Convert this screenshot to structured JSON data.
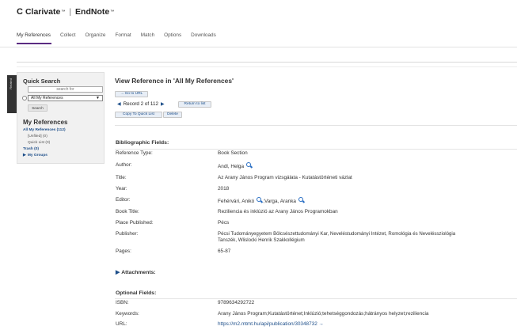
{
  "brand": {
    "logo": "C",
    "name": "Clarivate",
    "tm": "™",
    "product": "EndNote",
    "tm2": "™"
  },
  "nav": [
    "My References",
    "Collect",
    "Organize",
    "Format",
    "Match",
    "Options",
    "Downloads"
  ],
  "side_tab": "Related",
  "quick_search": {
    "title": "Quick Search",
    "search_placeholder": "search for",
    "select_value": "All My References",
    "search_button": "Search"
  },
  "my_references": {
    "title": "My References",
    "all": "All My References (112)",
    "unfiled": "[Unfiled] (0)",
    "quick_list": "Quick List (0)",
    "trash": "Trash (0)",
    "groups": "My Groups"
  },
  "view": {
    "title": "View Reference in 'All My References'",
    "goto_url": "Go to URL",
    "record_text": "Record 2 of 112",
    "return_to_list": "Return to list",
    "copy_to_quick_list": "Copy To Quick List",
    "delete": "Delete"
  },
  "bibliographic": {
    "heading": "Bibliographic Fields:",
    "reference_type_label": "Reference Type:",
    "reference_type": "Book Section",
    "author_label": "Author:",
    "author": "Andl, Helga",
    "title_label": "Title:",
    "title": "Az Arany János Program vizsgálata - Kutatástörténeti vázlat",
    "year_label": "Year:",
    "year": "2018",
    "editor_label": "Editor:",
    "editor_1": "Fehérvári, Anikó",
    "editor_sep": ";Varga, Aranka",
    "book_title_label": "Book Title:",
    "book_title": "Reziliencia és inklúzió az Arany János Programokban",
    "place_label": "Place Published:",
    "place": "Pécs",
    "publisher_label": "Publisher:",
    "publisher_line1": "Pécsi Tudományegyetem Bölcsészettudományi Kar, Neveléstudományi Intézet, Romológia és Neveléssziológia",
    "publisher_line2": "Tanszék, Wlislocki Henrik Szakkollégium",
    "pages_label": "Pages:",
    "pages": "65-87"
  },
  "attachments": {
    "label": "Attachments:"
  },
  "optional": {
    "heading": "Optional Fields:",
    "isbn_label": "ISBN:",
    "isbn": "9789634292722",
    "keywords_label": "Keywords:",
    "keywords": "Arany János Program;Kutatástörténet;Inklúzió;tehetséggondozás;hátrányos helyzet;reziliencia",
    "url_label": "URL:",
    "url": "https://m2.mtmt.hu/api/publication/30348732"
  }
}
